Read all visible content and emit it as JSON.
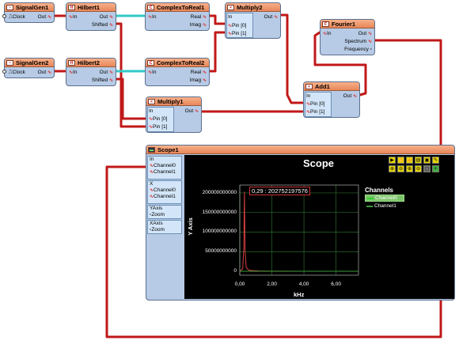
{
  "nodes": {
    "siggen1": {
      "title": "SignalGen1",
      "clock": "Clock",
      "out": "Out"
    },
    "hilbert1": {
      "title": "Hilbert1",
      "in": "In",
      "out": "Out",
      "shifted": "Shifted"
    },
    "ctr1": {
      "title": "ComplexToReal1",
      "in": "In",
      "real": "Real",
      "imag": "Imag"
    },
    "mult2": {
      "title": "Multiply2",
      "in": "In",
      "pin0": "Pin [0]",
      "pin1": "Pin [1]"
    },
    "fourier1": {
      "title": "Fourier1",
      "in": "In",
      "out": "Out",
      "spectrum": "Spectrum",
      "frequency": "Frequency"
    },
    "siggen2": {
      "title": "SignalGen2",
      "clock": "Clock",
      "out": "Out"
    },
    "hilbert2": {
      "title": "Hilbert2",
      "in": "In",
      "out": "Out",
      "shifted": "Shifted"
    },
    "ctr2": {
      "title": "ComplexToReal2",
      "in": "In",
      "real": "Real",
      "imag": "Imag"
    },
    "add1": {
      "title": "Add1",
      "in": "In",
      "out": "Out",
      "pin0": "Pin [0]",
      "pin1": "Pin [1]"
    },
    "mult1": {
      "title": "Multiply1",
      "in": "In",
      "out": "Out",
      "pin0": "Pin [0]",
      "pin1": "Pin [1]"
    }
  },
  "scope": {
    "node_title": "Scope1",
    "in_label": "In",
    "channel0": "Channel0",
    "channel1": "Channel1",
    "x_label": "X",
    "yaxis": "YAxis",
    "zoom": "Zoom",
    "xaxis": "XAxis",
    "title": "Scope",
    "channels_title": "Channels",
    "cursor_label": "0,29 : 202752197576",
    "ylabel": "Y Axis",
    "xlabel": "kHz",
    "ch0_color": "#2bd22b",
    "ch1_color": "#3b9b3b"
  },
  "chart_data": {
    "type": "line",
    "title": "Scope",
    "xlabel": "kHz",
    "ylabel": "Y Axis",
    "xlim": [
      0,
      7.4
    ],
    "ylim": [
      -10000000000,
      220000000000
    ],
    "x_ticks": [
      "0,00",
      "2,00",
      "4,00",
      "6,00"
    ],
    "y_ticks": [
      "0",
      "50000000000",
      "100000000000",
      "150000000000",
      "200000000000"
    ],
    "series": [
      {
        "name": "Channel0",
        "x": [
          0,
          0.18,
          0.25,
          0.29,
          0.33,
          0.4,
          0.55,
          0.8,
          1.2,
          2,
          3,
          4,
          5,
          6,
          7.4
        ],
        "y": [
          0,
          6000000000,
          60000000000,
          202752197576,
          50000000000,
          10000000000,
          3000000000,
          1500000000,
          800000000,
          400000000,
          250000000,
          180000000,
          140000000,
          110000000,
          90000000
        ]
      },
      {
        "name": "Channel1",
        "x": [
          0,
          7.4
        ],
        "y": [
          0,
          0
        ]
      }
    ],
    "grid": true
  }
}
